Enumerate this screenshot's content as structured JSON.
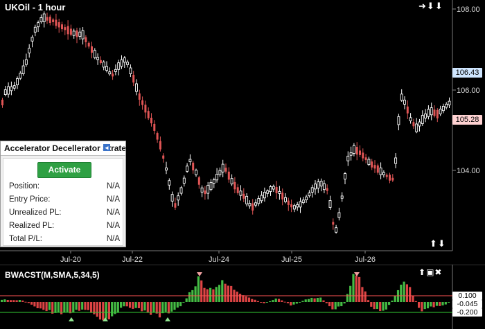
{
  "chart": {
    "title": "UKOil - 1 hour",
    "nav_icons": [
      "right-arrow-icon",
      "down-arrow-icon",
      "down-arrow-icon"
    ],
    "price_axis": {
      "ticks": [
        "108.00",
        "106.00",
        "104.00"
      ]
    },
    "last_price_tag": "106.43",
    "current_price_tag": "105.28",
    "date_axis": [
      "Jul-20",
      "Jul-22",
      "Jul-24",
      "Jul-25",
      "Jul-26"
    ],
    "bull_color": "#ffffff",
    "bear_color": "#e05555"
  },
  "strategy": {
    "title": "Accelerator Decellerator Strate",
    "activate_label": "Activate",
    "rows": [
      {
        "label": "Position:",
        "value": "N/A"
      },
      {
        "label": "Entry Price:",
        "value": "N/A"
      },
      {
        "label": "Unrealized PL:",
        "value": "N/A"
      },
      {
        "label": "Realized PL:",
        "value": "N/A"
      },
      {
        "label": "Total P/L:",
        "value": "N/A"
      }
    ]
  },
  "indicator": {
    "title": "BWACST(M,SMA,5,34,5)",
    "ticks": [
      "0.100",
      "-0.045",
      "-0.200"
    ],
    "upper_line_color": "#ff5555",
    "lower_line_color": "#33cc33",
    "up_color": "#44bb44",
    "down_color": "#dd4444"
  }
}
